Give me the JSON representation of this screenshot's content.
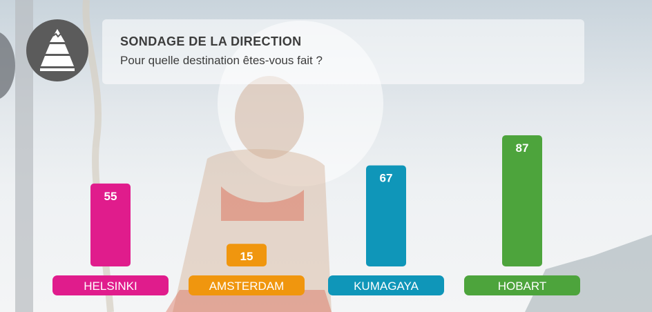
{
  "header": {
    "title": "SONDAGE DE LA DIRECTION",
    "subtitle": "Pour quelle destination êtes-vous fait ?"
  },
  "logo": {
    "icon": "tree-icon"
  },
  "chart_data": {
    "type": "bar",
    "categories": [
      "HELSINKI",
      "AMSTERDAM",
      "KUMAGAYA",
      "HOBART"
    ],
    "values": [
      55,
      15,
      67,
      87
    ],
    "colors": [
      "#e01c8c",
      "#f0960e",
      "#0f96b9",
      "#4da43c"
    ],
    "ylim": [
      0,
      87
    ],
    "title": "SONDAGE DE LA DIRECTION",
    "xlabel": "",
    "ylabel": ""
  }
}
